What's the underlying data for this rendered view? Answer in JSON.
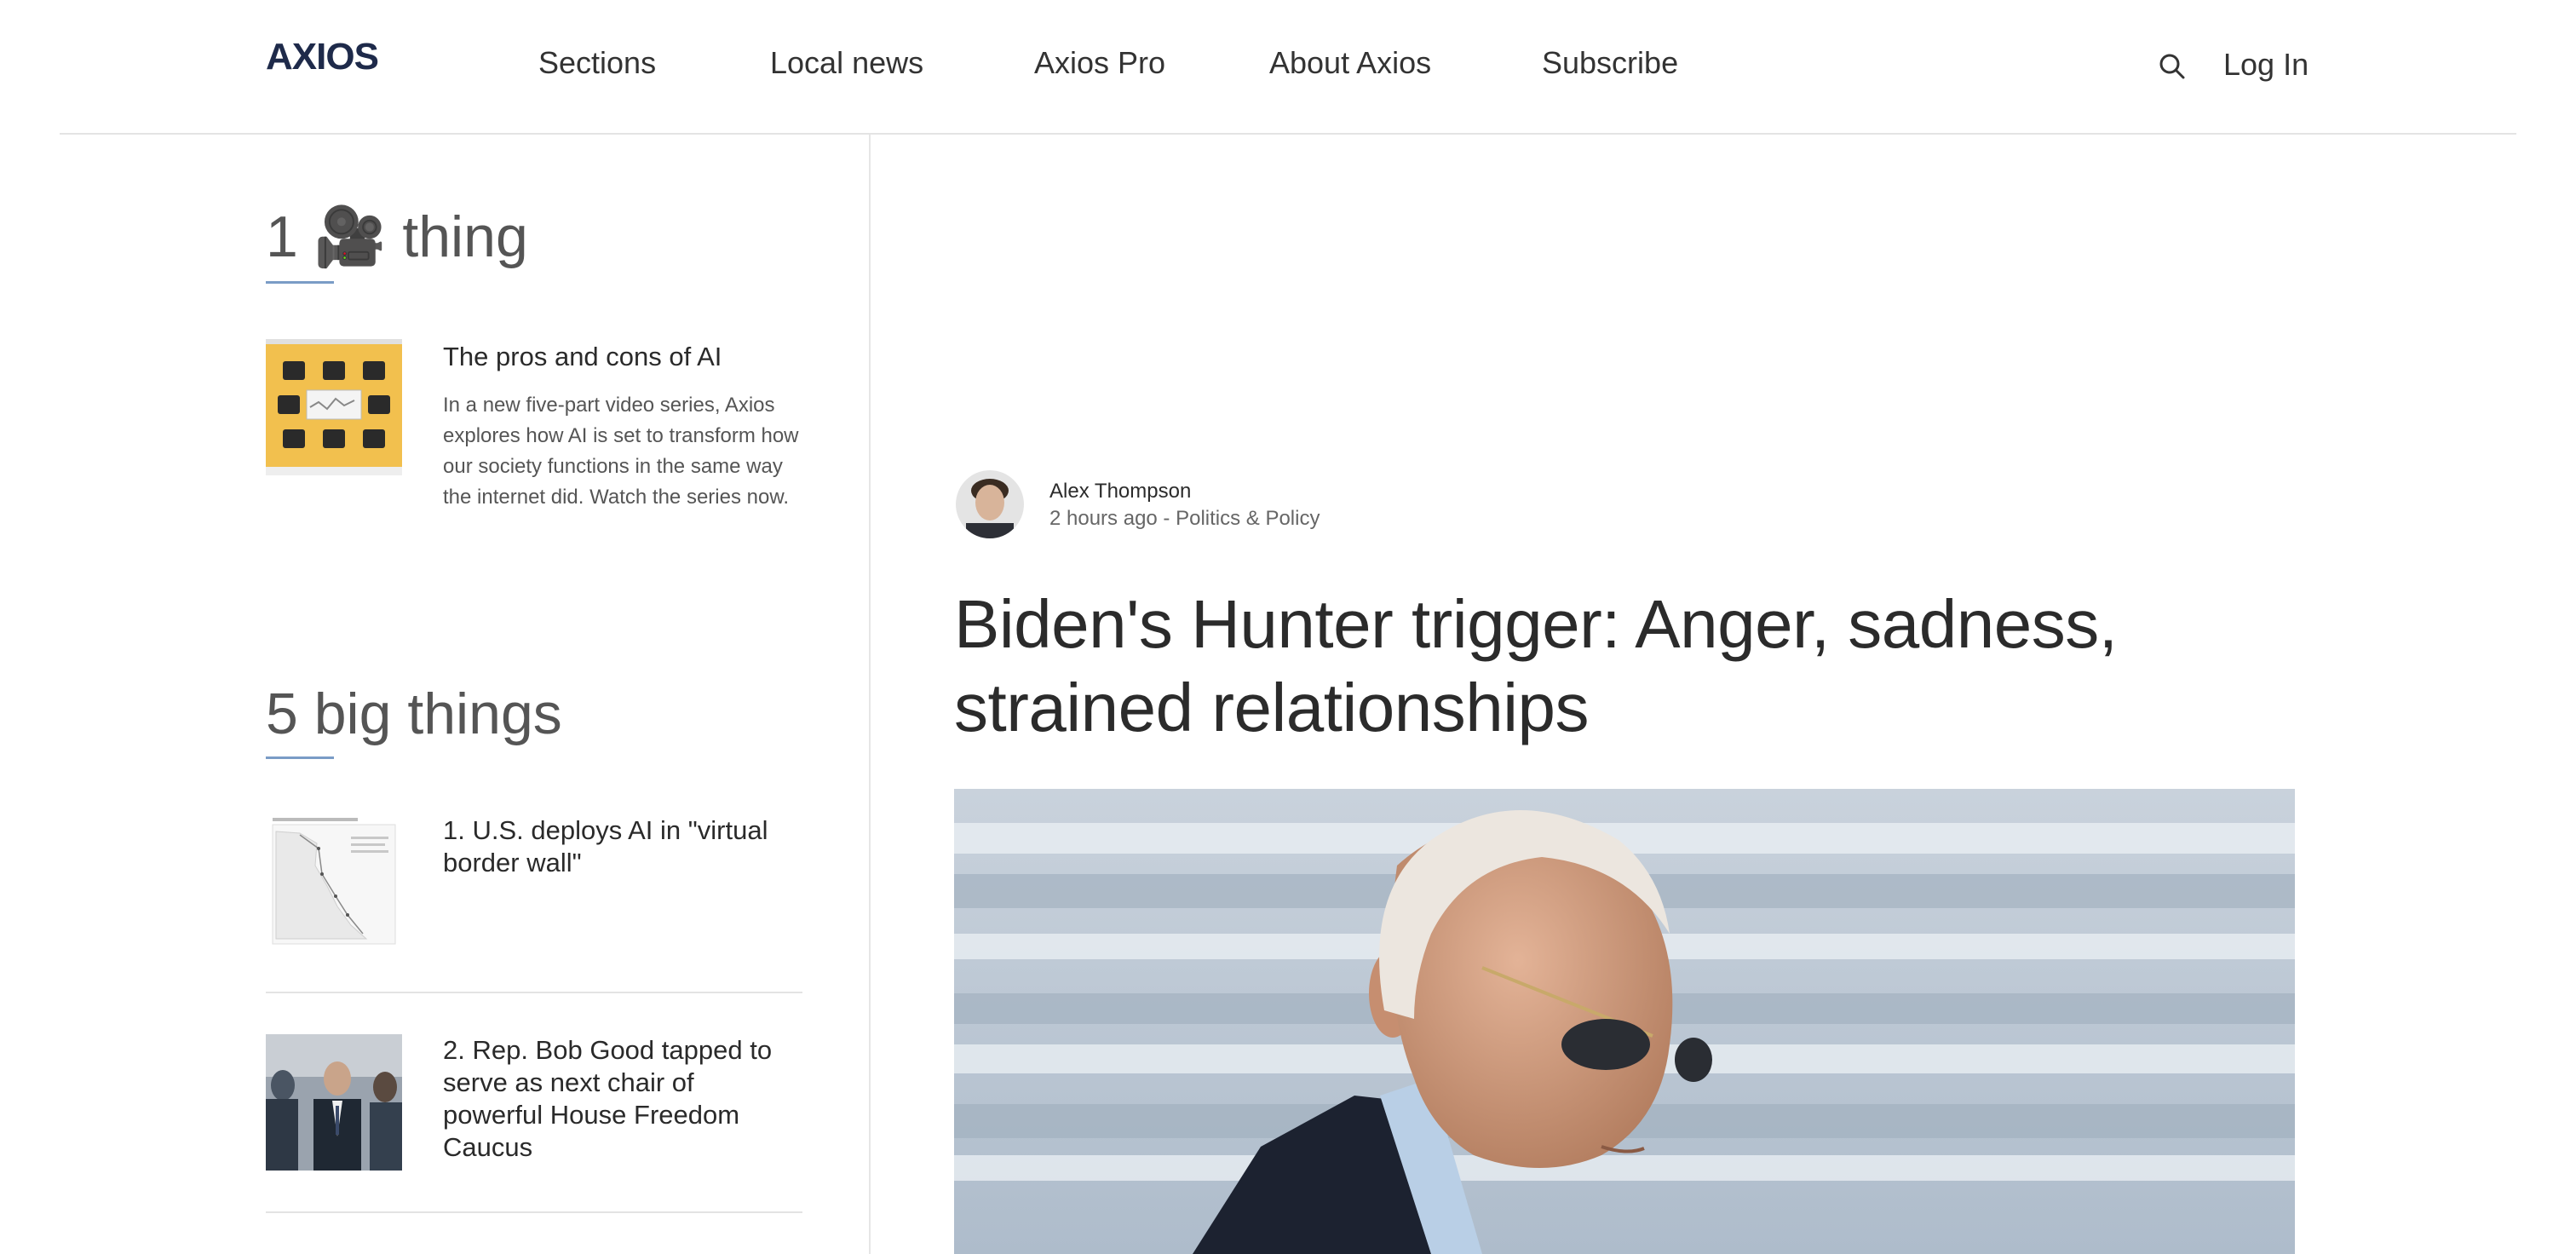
{
  "header": {
    "logo": "AXIOS",
    "nav": [
      "Sections",
      "Local news",
      "Axios Pro",
      "About Axios",
      "Subscribe"
    ],
    "search_icon": "search-icon",
    "login": "Log In"
  },
  "sidebar": {
    "one_thing": {
      "title_prefix": "1",
      "title_emoji": "🎥",
      "title_suffix": "thing",
      "story": {
        "headline": "The pros and cons of AI",
        "description": "In a new five-part video series, Axios explores how AI is set to transform how our society functions in the same way the internet did. Watch the series now."
      }
    },
    "big_things": {
      "title": "5 big things",
      "items": [
        {
          "headline": "1. U.S. deploys AI in \"virtual border wall\""
        },
        {
          "headline": "2. Rep. Bob Good tapped to serve as next chair of powerful House Freedom Caucus"
        }
      ]
    }
  },
  "article": {
    "author": "Alex Thompson",
    "byline": "2 hours ago - Politics & Policy",
    "headline": "Biden's Hunter trigger: Anger, sadness, strained relationships"
  },
  "colors": {
    "accent_underline": "#7a9cc6",
    "logo": "#1e2a4a",
    "thumb_yellow": "#f2c04e"
  }
}
